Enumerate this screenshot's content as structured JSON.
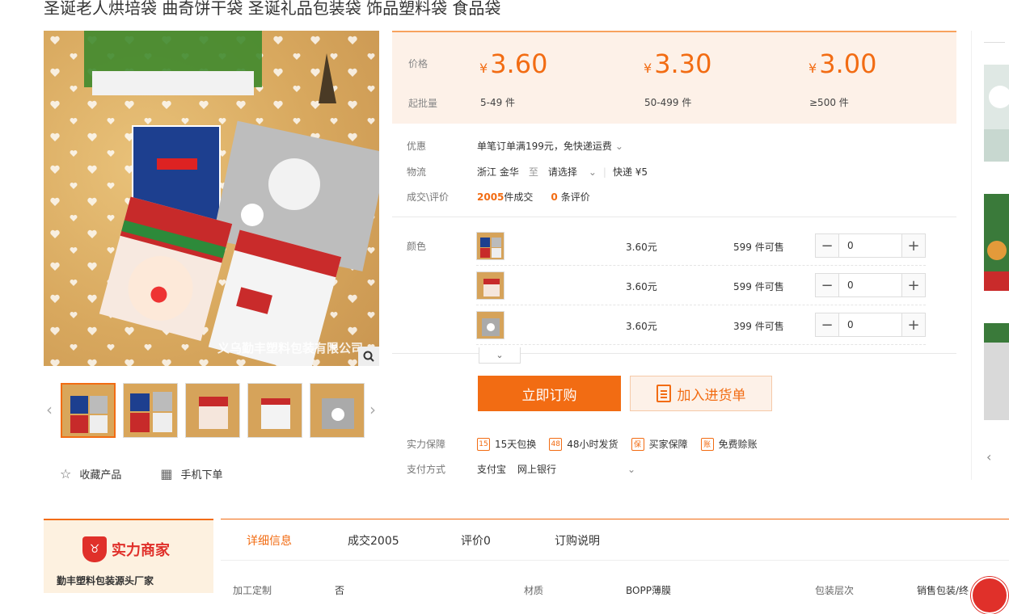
{
  "title": "圣诞老人烘培袋 曲奇饼干袋 圣诞礼品包装袋 饰品塑料袋 食品袋",
  "gallery": {
    "watermark": "义乌勤丰塑料包装有限公司",
    "prev_arrow": "‹",
    "next_arrow": "›"
  },
  "actions": {
    "favorite": "收藏产品",
    "mobile": "手机下单"
  },
  "price": {
    "price_label": "价格",
    "batch_label": "起批量",
    "currency": "¥",
    "tiers": [
      {
        "price": "3.60",
        "batch": "5-49 件"
      },
      {
        "price": "3.30",
        "batch": "50-499 件"
      },
      {
        "price": "3.00",
        "batch": "≥500 件"
      }
    ]
  },
  "info": {
    "promo_label": "优惠",
    "promo_text": "单笔订单满199元，免快递运费",
    "logistics_label": "物流",
    "origin": "浙江 金华",
    "to": "至",
    "dest": "请选择",
    "express": "快递 ¥5",
    "deals_label": "成交\\评价",
    "deal_count": "2005",
    "deal_suffix": "件成交",
    "review_count": "0",
    "review_suffix": "条评价"
  },
  "sku": {
    "label": "颜色",
    "rows": [
      {
        "price": "3.60元",
        "stock": "599 件可售",
        "qty": "0"
      },
      {
        "price": "3.60元",
        "stock": "599 件可售",
        "qty": "0"
      },
      {
        "price": "3.60元",
        "stock": "399 件可售",
        "qty": "0"
      }
    ]
  },
  "buttons": {
    "buy": "立即订购",
    "cart": "加入进货单"
  },
  "guarantee": {
    "label": "实力保障",
    "items": [
      {
        "icon": "15",
        "text": "15天包换"
      },
      {
        "icon": "48",
        "text": "48小时发货"
      },
      {
        "icon": "保",
        "text": "买家保障"
      },
      {
        "icon": "账",
        "text": "免费赊账"
      }
    ]
  },
  "payment": {
    "label": "支付方式",
    "methods": [
      "支付宝",
      "网上银行"
    ]
  },
  "shop": {
    "badge": "实力商家",
    "name": "勤丰塑料包装源头厂家"
  },
  "tabs": [
    "详细信息",
    "成交2005",
    "评价0",
    "订购说明"
  ],
  "attrs": {
    "custom_label": "加工定制",
    "custom_value": "否",
    "material_label": "材质",
    "material_value": "BOPP薄膜",
    "layer_label": "包装层次",
    "layer_value": "销售包装/终"
  },
  "colors": {
    "accent": "#f26c13",
    "price_bg": "#fdf1e8"
  }
}
